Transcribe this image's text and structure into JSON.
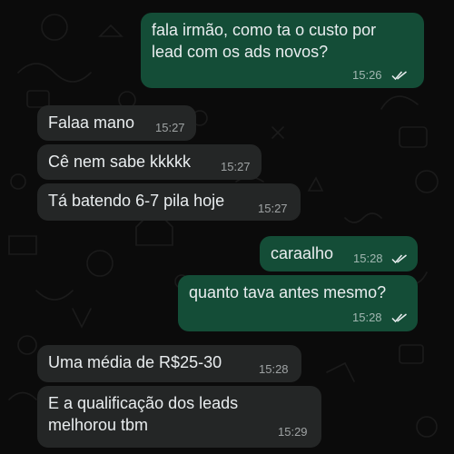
{
  "theme": {
    "background": "#0b0b0b",
    "incoming_bubble": "#242626",
    "outgoing_bubble": "#144d37",
    "text": "#e9edef",
    "read_ticks": "#e9edef"
  },
  "messages": [
    {
      "direction": "outgoing",
      "text": "fala irmão, como ta o custo por\nlead com os ads novos?",
      "time": "15:26",
      "status": "read-double-check-icon"
    },
    {
      "direction": "incoming",
      "text": "Falaa mano",
      "time": "15:27"
    },
    {
      "direction": "incoming",
      "text": "Cê nem sabe kkkkk",
      "time": "15:27"
    },
    {
      "direction": "incoming",
      "text": "Tá batendo 6-7 pila hoje",
      "time": "15:27"
    },
    {
      "direction": "outgoing",
      "text": "caraalho",
      "time": "15:28",
      "status": "read-double-check-icon"
    },
    {
      "direction": "outgoing",
      "text": "quanto tava antes mesmo?",
      "time": "15:28",
      "status": "read-double-check-icon"
    },
    {
      "direction": "incoming",
      "text": "Uma média de R$25-30",
      "time": "15:28"
    },
    {
      "direction": "incoming",
      "text": "E a qualificação dos leads\nmelhorou tbm",
      "time": "15:29"
    }
  ]
}
